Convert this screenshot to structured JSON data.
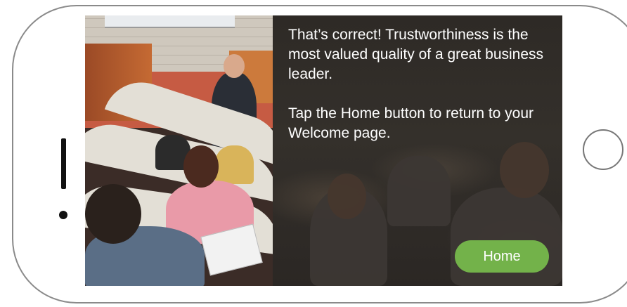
{
  "screen": {
    "message_line1": "That’s correct! Trustworthiness is the most valued quality of a great business leader.",
    "message_line2": "Tap the Home button to return to your Welcome page.",
    "home_button_label": "Home"
  },
  "colors": {
    "home_button": "#73b24a",
    "text": "#ffffff",
    "device_border": "#8a8a8a"
  },
  "icons": {
    "device_speaker": "speaker-slot",
    "device_camera": "camera-dot",
    "device_home": "home-button-circle"
  }
}
